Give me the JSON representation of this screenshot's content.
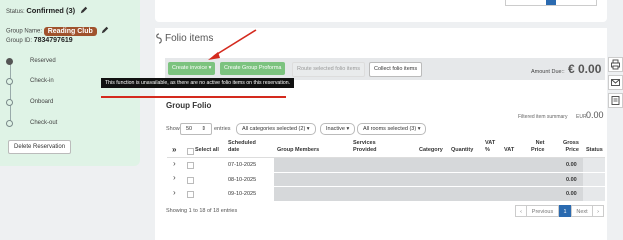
{
  "left": {
    "status_label": "Status:",
    "status_value": "Confirmed (3)",
    "group_name_label": "Group Name:",
    "group_name": "Reading Club",
    "group_id_label": "Group ID:",
    "group_id": "7834797619",
    "timeline": [
      "Reserved",
      "Check-in",
      "Onboard",
      "Check-out"
    ],
    "delete_button": "Delete Reservation"
  },
  "folio": {
    "title": "Folio items",
    "buttons": {
      "create_invoice": "Create invoice ▾",
      "create_proforma": "Create Group Proforma",
      "route": "Route selected folio items",
      "collect": "Collect folio items"
    },
    "amount_due_label": "Amount Due::",
    "amount_due": "€ 0.00",
    "tooltip": "This function is unavailable, as there are no active folio items on this reservation."
  },
  "group_folio": {
    "title": "Group Folio",
    "filtered_label": "Filtered item summary",
    "eur_label": "EUR",
    "eur_value": "0.00",
    "show_label": "Show",
    "show_value": "50",
    "entries_label": "entries",
    "filters": [
      "All categories selected (2) ▾",
      "Inactive ▾",
      "All rooms selected (3) ▾"
    ],
    "columns": {
      "expand": "»",
      "select_all": "Select all",
      "scheduled": "Scheduled\ndate",
      "members": "Group Members",
      "services": "Services\nProvided",
      "category": "Category",
      "quantity": "Quantity",
      "vat_pct": "VAT\n%",
      "vat": "VAT",
      "net": "Net\nPrice",
      "gross": "Gross\nPrice",
      "status": "Status"
    },
    "rows": [
      {
        "date": "07-10-2025",
        "gross": "0.00"
      },
      {
        "date": "08-10-2025",
        "gross": "0.00"
      },
      {
        "date": "09-10-2025",
        "gross": "0.00"
      }
    ],
    "showing": "Showing 1 to 18 of 18 entries",
    "pagination": {
      "prev": "Previous",
      "page": "1",
      "next": "Next"
    }
  },
  "colors": {
    "accent_green": "#7cc37f",
    "annotation_red": "#d42a1e",
    "page_active": "#2a6ab0",
    "badge_brown": "#a0522d"
  }
}
